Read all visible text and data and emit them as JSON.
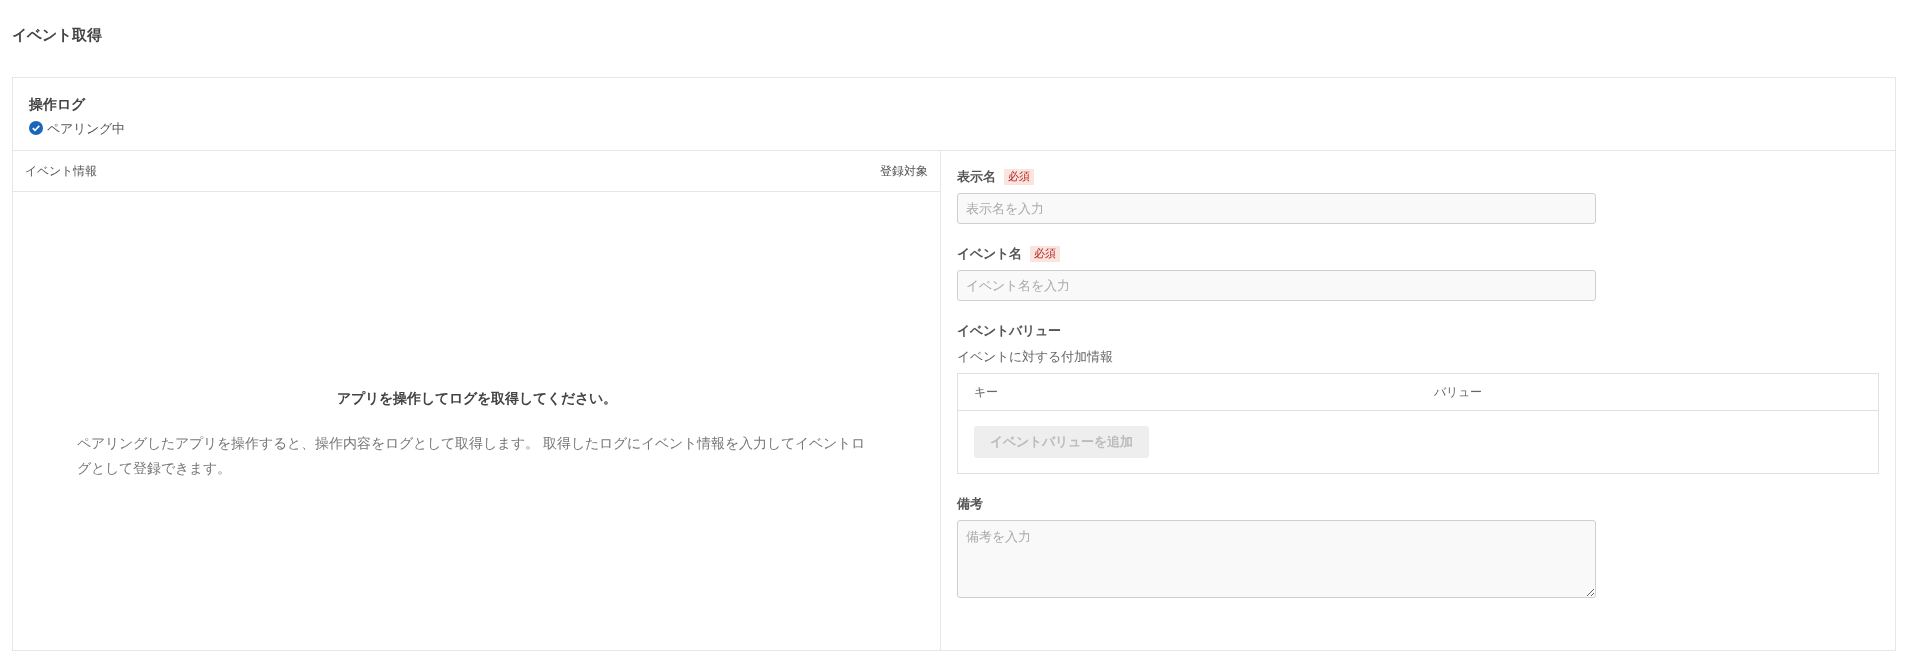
{
  "page_title": "イベント取得",
  "log_card": {
    "title": "操作ログ",
    "status": {
      "label": "ペアリング中",
      "paired": true
    }
  },
  "event_list": {
    "columns": [
      "イベント情報",
      "登録対象"
    ],
    "empty_title": "アプリを操作してログを取得してください。",
    "empty_message": "ペアリングしたアプリを操作すると、操作内容をログとして取得します。 取得したログにイベント情報を入力してイベントログとして登録できます。"
  },
  "form": {
    "fields": [
      {
        "kind": "input",
        "label": "表示名",
        "badge": "必須",
        "placeholder": "表示名を入力"
      },
      {
        "kind": "input",
        "label": "イベント名",
        "badge": "必須",
        "placeholder": "イベント名を入力"
      },
      {
        "kind": "key_value",
        "label": "イベントバリュー",
        "description": "イベントに対する付加情報",
        "columns": [
          "キー",
          "バリュー"
        ],
        "add_button": {
          "label": "イベントバリューを追加",
          "disabled": true
        }
      },
      {
        "kind": "textarea",
        "label": "備考",
        "placeholder": "備考を入力"
      }
    ]
  }
}
